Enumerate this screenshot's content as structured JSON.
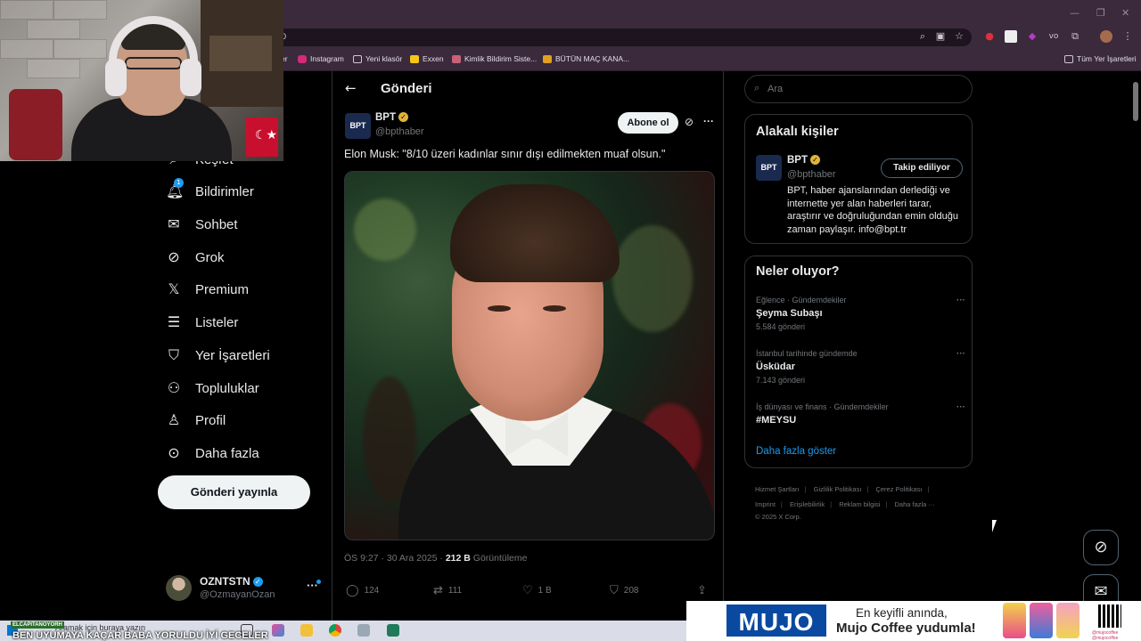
{
  "browser": {
    "bookmarks": [
      {
        "label": "Instagram",
        "color": "#d62976"
      },
      {
        "label": "Yeni klasör",
        "color": "#9a8f9c"
      },
      {
        "label": "Exxen",
        "color": "#f5c518"
      },
      {
        "label": "Kimlik Bildirim Siste...",
        "color": "#c9607a"
      },
      {
        "label": "BÜTÜN MAÇ KANA...",
        "color": "#e0a020"
      }
    ],
    "all_bookmarks": "Tüm Yer İşaretleri",
    "partial_bookmark": "er",
    "partial_url": "0"
  },
  "nav": {
    "items": [
      {
        "label": "Keşfet",
        "icon": "search-icon"
      },
      {
        "label": "Bildirimler",
        "icon": "bell-icon",
        "badge": "1"
      },
      {
        "label": "Sohbet",
        "icon": "envelope-icon"
      },
      {
        "label": "Grok",
        "icon": "grok-icon"
      },
      {
        "label": "Premium",
        "icon": "x-logo-icon"
      },
      {
        "label": "Listeler",
        "icon": "list-icon"
      },
      {
        "label": "Yer İşaretleri",
        "icon": "bookmark-icon"
      },
      {
        "label": "Topluluklar",
        "icon": "people-icon"
      },
      {
        "label": "Profil",
        "icon": "person-icon"
      },
      {
        "label": "Daha fazla",
        "icon": "more-circle-icon"
      }
    ],
    "post_button": "Gönderi yayınla"
  },
  "account": {
    "name": "OZNTSTN",
    "handle": "@OzmayanOzan"
  },
  "post": {
    "page_title": "Gönderi",
    "author_name": "BPT",
    "author_handle": "@bpthaber",
    "avatar_text": "BPT",
    "subscribe": "Abone ol",
    "text": "Elon Musk: \"8/10 üzeri kadınlar sınır dışı edilmekten muaf olsun.\"",
    "time": "ÖS 9:27 · 30 Ara 2025 · ",
    "views": "212 B",
    "views_label": " Görüntüleme",
    "replies": "124",
    "reposts": "111",
    "likes": "1 B",
    "bookmarks": "208"
  },
  "search": {
    "placeholder": "Ara"
  },
  "related": {
    "title": "Alakalı kişiler",
    "name": "BPT",
    "handle": "@bpthaber",
    "follow": "Takip ediliyor",
    "bio": "BPT, haber ajanslarından derlediği ve internette yer alan haberleri tarar, araştırır ve doğruluğundan emin olduğu zaman paylaşır. info@bpt.tr"
  },
  "trends": {
    "title": "Neler oluyor?",
    "items": [
      {
        "context": "Eğlence · Gündemdekiler",
        "title": "Şeyma Subaşı",
        "count": "5.584 gönderi"
      },
      {
        "context": "İstanbul tarihinde gündemde",
        "title": "Üsküdar",
        "count": "7.143 gönderi"
      },
      {
        "context": "İş dünyası ve finans · Gündemdekiler",
        "title": "#MEYSU",
        "count": ""
      }
    ],
    "show_more": "Daha fazla göster"
  },
  "footer": {
    "line1": [
      "Hizmet Şartları",
      "Gizlilik Politikası",
      "Çerez Politikası"
    ],
    "line2": [
      "Imprint",
      "Erişilebilirlik",
      "Reklam bilgisi",
      "Daha fazla ···"
    ],
    "copyright": "© 2025 X Corp."
  },
  "taskbar": {
    "search_placeholder": "Aramak için buraya yazın",
    "channel": "ELCAPITANOYORH",
    "ticker": "BEN UYUMAYA KAÇAR BABA YORULDU İYİ GECELER"
  },
  "ad": {
    "brand": "MUJO",
    "line1": "En keyifli anında,",
    "line2": "Mujo Coffee yudumla!",
    "handle1": "@mujocoffee",
    "handle2": "@mujocoffee"
  },
  "webcam": {
    "flag_symbol": "☾★"
  }
}
